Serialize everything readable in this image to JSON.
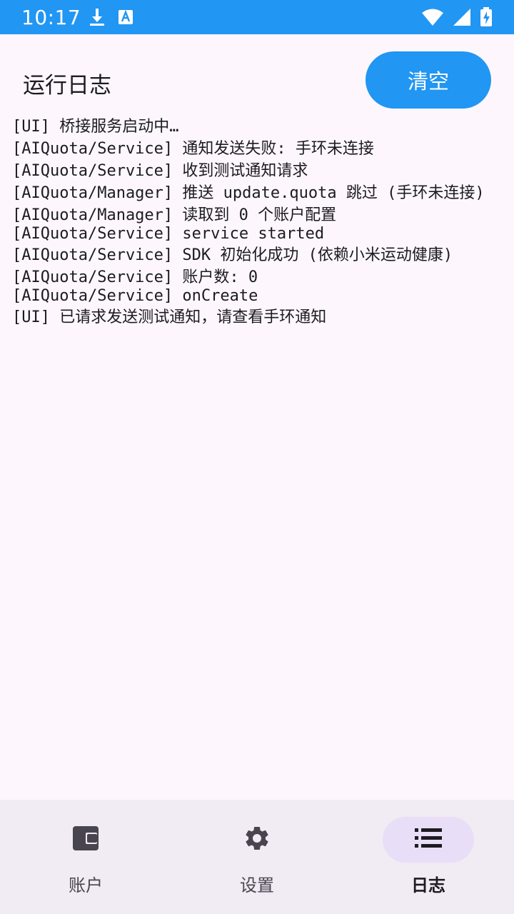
{
  "status_bar": {
    "time": "10:17",
    "left_icons": [
      "download-icon",
      "translate-icon"
    ],
    "right_icons": [
      "wifi-icon",
      "cellular-signal-icon",
      "battery-charging-icon"
    ],
    "color": "#2196f3"
  },
  "header": {
    "title": "运行日志",
    "clear_label": "清空"
  },
  "logs": [
    "[UI] 桥接服务启动中…",
    "[AIQuota/Service] 通知发送失败: 手环未连接",
    "[AIQuota/Service] 收到测试通知请求",
    "[AIQuota/Manager] 推送 update.quota 跳过 (手环未连接)",
    "[AIQuota/Manager] 读取到 0 个账户配置",
    "[AIQuota/Service] service started",
    "[AIQuota/Service] SDK 初始化成功 (依赖小米运动健康)",
    "[AIQuota/Service] 账户数: 0",
    "[AIQuota/Service] onCreate",
    "[UI] 已请求发送测试通知，请查看手环通知"
  ],
  "bottom_nav": {
    "items": [
      {
        "label": "账户",
        "icon": "wallet-icon",
        "active": false
      },
      {
        "label": "设置",
        "icon": "gear-icon",
        "active": false
      },
      {
        "label": "日志",
        "icon": "list-icon",
        "active": true
      }
    ]
  },
  "colors": {
    "accent": "#2196f3",
    "background": "#fdf7fd",
    "nav_background": "#f1ebf3",
    "nav_active_indicator": "#e8def8"
  }
}
